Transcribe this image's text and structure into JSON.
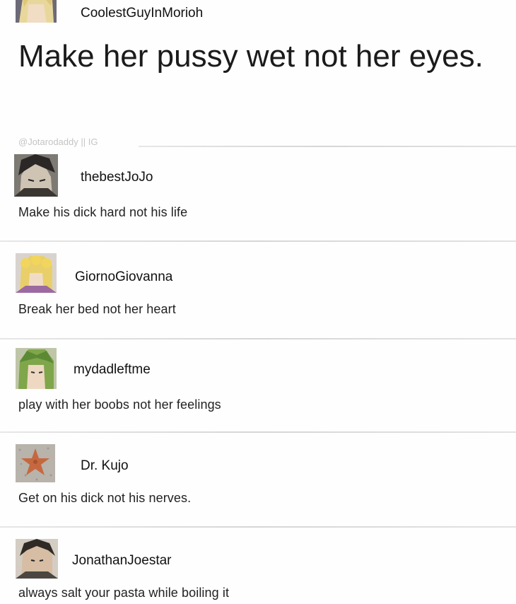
{
  "posts": [
    {
      "username": "CoolestGuyInMorioh",
      "text": "Make her pussy wet not her eyes.",
      "credit": "@Jotarodaddy || IG",
      "avatar_icon": "anime-character-avatar-blond"
    },
    {
      "username": "thebestJoJo",
      "text": "Make his dick hard not his life",
      "avatar_icon": "anime-character-avatar-dark-hair"
    },
    {
      "username": "GiornoGiovanna",
      "text": "Break her bed not her heart",
      "avatar_icon": "anime-character-avatar-golden-hair"
    },
    {
      "username": "mydadleftme",
      "text": "play with her boobs not her feelings",
      "avatar_icon": "anime-character-avatar-green-hair"
    },
    {
      "username": "Dr. Kujo",
      "text": "Get on his dick not his nerves.",
      "avatar_icon": "starfish-avatar"
    },
    {
      "username": "JonathanJoestar",
      "text": "always salt your pasta while boiling it",
      "avatar_icon": "anime-character-avatar-dark-hair-2"
    }
  ],
  "colors": {
    "background": "#fefefe",
    "divider": "#dcdcdc",
    "credit": "#c4c4c4",
    "text": "#222222"
  }
}
